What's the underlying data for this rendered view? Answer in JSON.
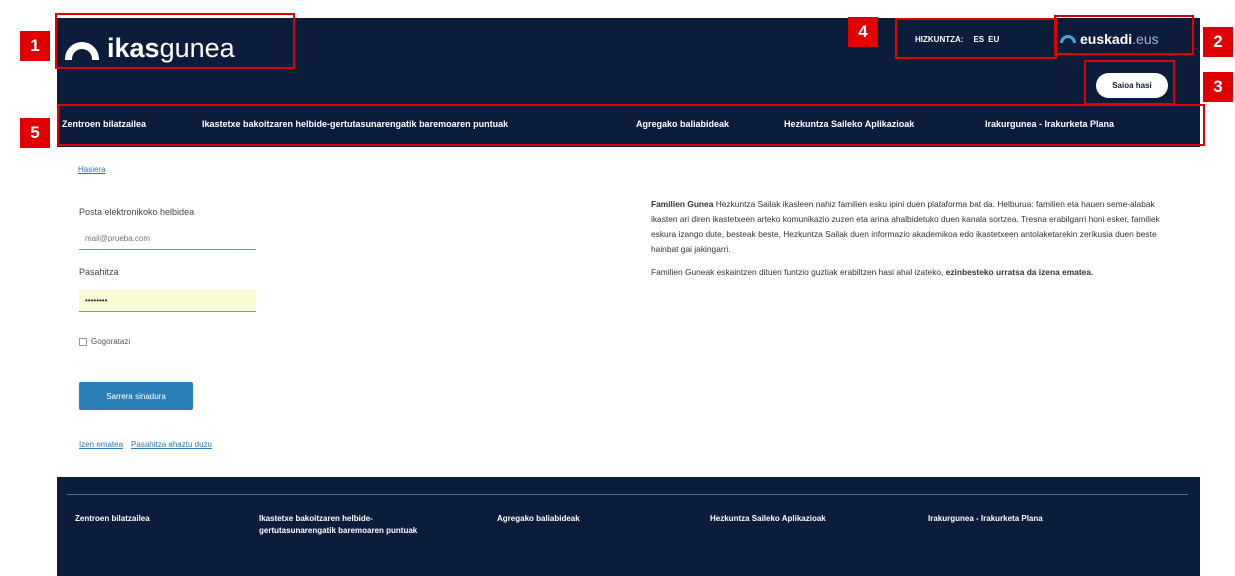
{
  "header": {
    "logo_bold": "ikas",
    "logo_light": "gunea",
    "language_label": "HIZKUNTZA:",
    "language_options": [
      "ES",
      "EU"
    ],
    "euskadi_bold": "euskadi",
    "euskadi_light": ".eus",
    "login_button": "Saioa hasi"
  },
  "nav": {
    "items": [
      "Zentroen bilatzailea",
      "Ikastetxe bakoitzaren helbide-gertutasunarengatik baremoaren puntuak",
      "Agregako baliabideak",
      "Hezkuntza Saileko Aplikazioak",
      "Irakurgunea - Irakurketa Plana"
    ]
  },
  "annotations": [
    "1",
    "2",
    "3",
    "4",
    "5"
  ],
  "breadcrumb": "Hasiera",
  "form": {
    "email_label": "Posta elektronikoko helbidea",
    "email_placeholder": "mail@prueba.com",
    "password_label": "Pasahitza",
    "password_value": "••••••••",
    "remember_label": "Gogoratazi",
    "submit_label": "Sarrera sinadura",
    "register_link": "Izen ematea",
    "forgot_link": "Pasahitza ahaztu duzu"
  },
  "info": {
    "p1_bold": "Familien Gunea",
    "p1_text": " Hezkuntza Sailak ikasleen nahiz familien esku ipini duen plataforma bat da. Helburua: familien eta hauen seme-alabak ikasten ari diren ikastetxeen arteko komunikazio zuzen eta arina ahalbidetuko duen kanala sortzea. Tresna erabilgarri honi esker, familiek eskura izango dute, besteak beste, Hezkuntza Sailak duen informazio akademikoa edo ikastetxeen antolaketarekin zerikusia duen beste hainbat gai jakingarri.",
    "p2_text": "Familien Guneak eskaintzen dituen funtzio guztiak erabiltzen hasi ahal izateko, ",
    "p2_bold": "ezinbesteko urratsa da izena ematea."
  },
  "footer": {
    "items": [
      "Zentroen bilatzailea",
      "Ikastetxe bakoitzaren helbide-gertutasunarengatik baremoaren puntuak",
      "Agregako baliabideak",
      "Hezkuntza Saileko Aplikazioak",
      "Irakurgunea - Irakurketa Plana"
    ]
  }
}
